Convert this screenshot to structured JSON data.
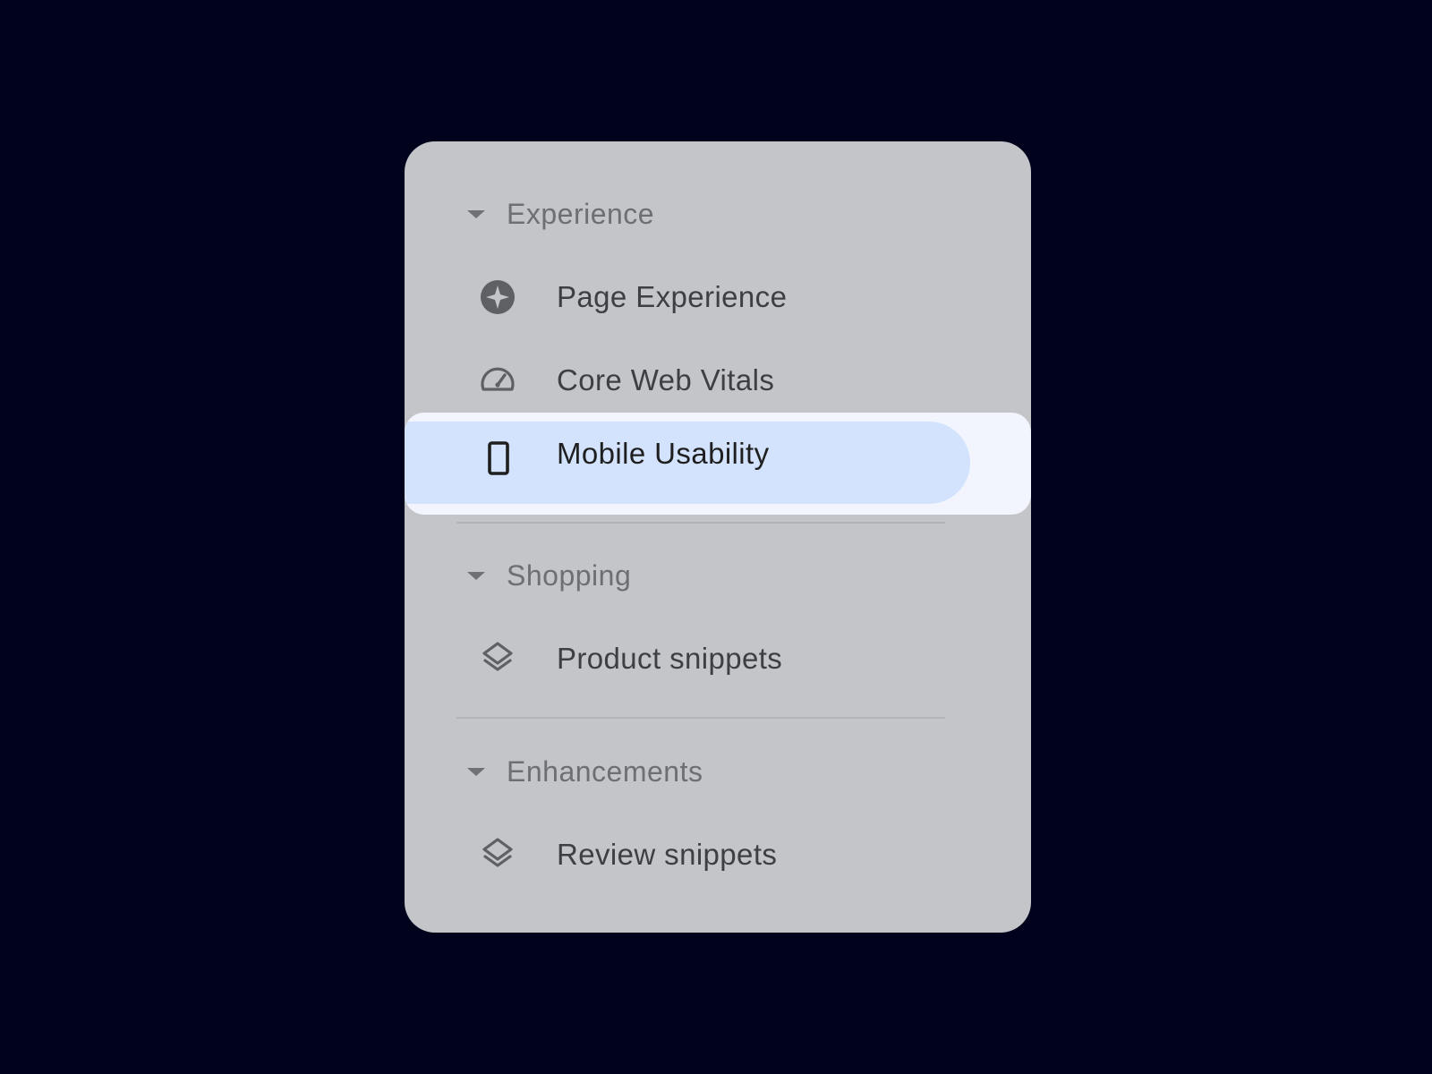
{
  "colors": {
    "background": "#01031d",
    "panel": "#c3c5c9",
    "highlight_strip": "#f2f5fd",
    "selected_pill": "#d3e3fd",
    "divider": "#b1b4b8",
    "header_text": "#6d6f73",
    "item_text": "#3e3f42"
  },
  "sections": [
    {
      "label": "Experience",
      "icon": "caret-down-icon",
      "items": [
        {
          "label": "Page Experience",
          "icon": "page-experience-icon"
        },
        {
          "label": "Core Web Vitals",
          "icon": "speedometer-icon"
        },
        {
          "label": "Mobile Usability",
          "icon": "smartphone-icon",
          "selected": true
        }
      ]
    },
    {
      "label": "Shopping",
      "icon": "caret-down-icon",
      "items": [
        {
          "label": "Product snippets",
          "icon": "layers-icon"
        }
      ]
    },
    {
      "label": "Enhancements",
      "icon": "caret-down-icon",
      "items": [
        {
          "label": "Review snippets",
          "icon": "layers-icon"
        }
      ]
    }
  ]
}
